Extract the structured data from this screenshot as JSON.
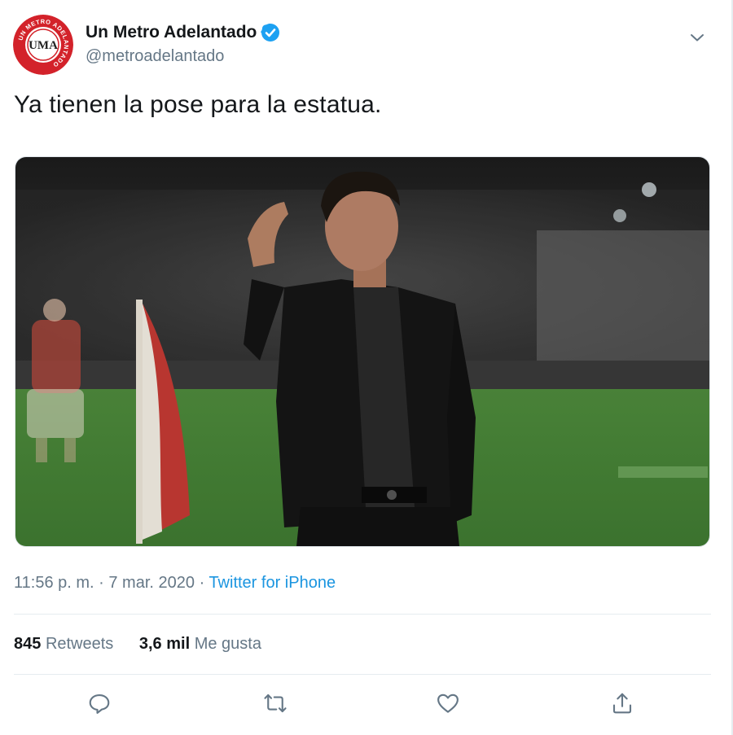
{
  "author": {
    "display_name": "Un Metro Adelantado",
    "handle": "@metroadelantado",
    "avatar_text": "UMA",
    "avatar_ring_text": "UN METRO ADELANTADO",
    "verified_icon": "verified-badge-icon"
  },
  "tweet": {
    "text": "Ya tienen la pose para la estatua.",
    "time": "11:56 p. m.",
    "separator": "·",
    "date": "7 mar. 2020",
    "source": "Twitter for iPhone"
  },
  "stats": {
    "retweets_count": "845",
    "retweets_label": "Retweets",
    "likes_count": "3,6 mil",
    "likes_label": "Me gusta"
  },
  "actions": [
    "reply-icon",
    "retweet-icon",
    "like-icon",
    "share-icon"
  ],
  "colors": {
    "link": "#1b95e0",
    "secondary_text": "#657786",
    "primary_text": "#14171a",
    "verified": "#1da1f2",
    "avatar_red": "#d3222a"
  }
}
